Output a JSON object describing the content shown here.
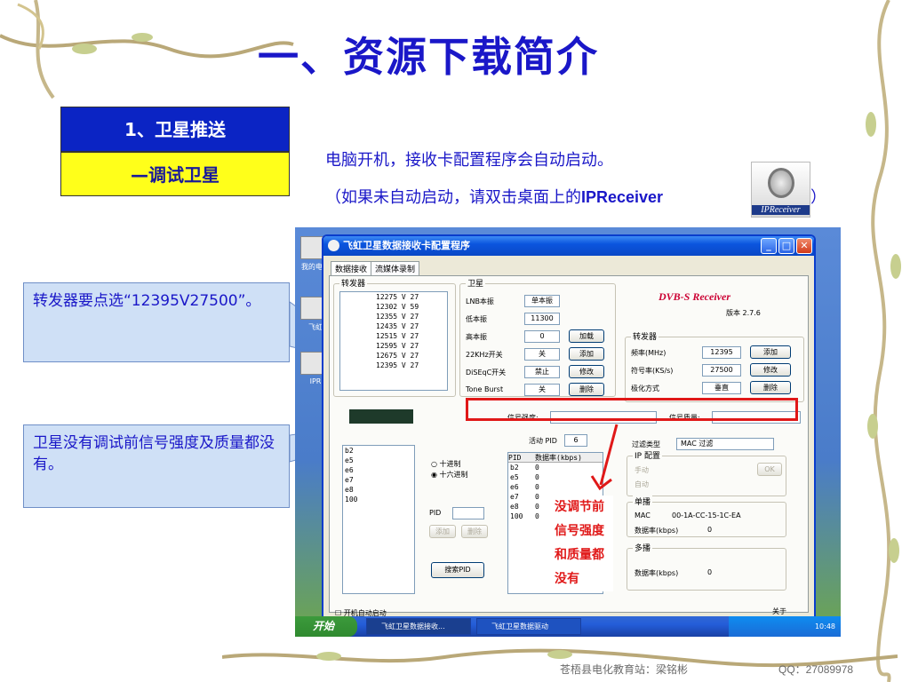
{
  "slide": {
    "title": "一、资源下载简介",
    "box1": "1、卫星推送",
    "box2": "—调试卫星",
    "desc_line1": "电脑开机，接收卡配置程序会自动启动。",
    "desc_line2_prefix": "（如果未自动启动，请双击桌面上的",
    "desc_line2_bold": "IPReceiver",
    "desc_line2_suffix": "）",
    "ipreceiver_icon_label": "IPReceiver",
    "callout1": "转发器要点选“12395V27500”。",
    "callout2": "卫星没有调试前信号强度及质量都没有。",
    "footer_left": "苍梧县电化教育站：梁铭彬",
    "footer_qq": "QQ：27089978"
  },
  "app": {
    "window_title": "飞虹卫星数据接收卡配置程序",
    "tabs": [
      "数据接收",
      "流媒体录制"
    ],
    "transponder_group": "转发器",
    "transponder_list": [
      "12275 V 27",
      "12302 V 59",
      "12355 V 27",
      "12435 V 27",
      "12515 V 27",
      "12595 V 27",
      "12675 V 27",
      "12395 V 27"
    ],
    "satellite_group": "卫星",
    "lnb_type_label": "LNB本振",
    "lnb_type_value": "单本振",
    "low_osc_label": "低本振",
    "low_osc_value": "11300",
    "high_osc_label": "高本振",
    "high_osc_value": "0",
    "khz22_label": "22KHz开关",
    "khz22_value": "关",
    "diseqc_label": "DiSEqC开关",
    "diseqc_value": "禁止",
    "toneburst_label": "Tone Burst",
    "toneburst_value": "关",
    "btn_load": "加载",
    "btn_add": "添加",
    "btn_modify": "修改",
    "btn_delete": "删除",
    "dvb_title": "DVB-S Receiver",
    "version": "版本 2.7.6",
    "tp_group": "转发器",
    "freq_label": "频率(MHz)",
    "freq_value": "12395",
    "symrate_label": "符号率(KS/s)",
    "symrate_value": "27500",
    "polar_label": "极化方式",
    "polar_value": "垂直",
    "signal_strength_label": "信号强度:",
    "signal_quality_label": "信号质量:",
    "active_pid_label": "活动 PID",
    "active_pid_value": "6",
    "pid_list_left": [
      "b2",
      "e5",
      "e6",
      "e7",
      "e8",
      "100"
    ],
    "radix_hex": "十进制",
    "radix_dec": "十六进制",
    "pid_col": "PID",
    "rate_col": "数据率(kbps)",
    "pid_table_rows": [
      [
        "b2",
        "0"
      ],
      [
        "e5",
        "0"
      ],
      [
        "e6",
        "0"
      ],
      [
        "e7",
        "0"
      ],
      [
        "e8",
        "0"
      ],
      [
        "100",
        "0"
      ]
    ],
    "pid_label": "PID",
    "btn_add_pid": "添加",
    "btn_del_pid": "删除",
    "btn_search_pid": "搜索PID",
    "filter_label": "过滤类型",
    "filter_value": "MAC 过滤",
    "ip_group": "IP 配置",
    "ip_manual": "手动",
    "ip_auto": "自动",
    "btn_ok": "OK",
    "unicast_group": "单播",
    "mac_label": "MAC",
    "mac_value": "00-1A-CC-15-1C-EA",
    "rate_label": "数据率(kbps)",
    "rate_value": "0",
    "multicast_group": "多播",
    "multicast_rate_value": "0",
    "autostart_label": "开机自动启动",
    "close_label": "关于",
    "red_annotation": [
      "没调节前",
      "信号强度",
      "和质量都",
      "没有"
    ],
    "taskbar_start": "开始",
    "taskbar_task1": "飞虹卫星数据接收...",
    "taskbar_task2": "飞虹卫星数据驱动",
    "clock": "10:48",
    "desktop_icon1": "我的电脑",
    "desktop_icon2": "飞虹",
    "desktop_icon3": "IPR"
  }
}
